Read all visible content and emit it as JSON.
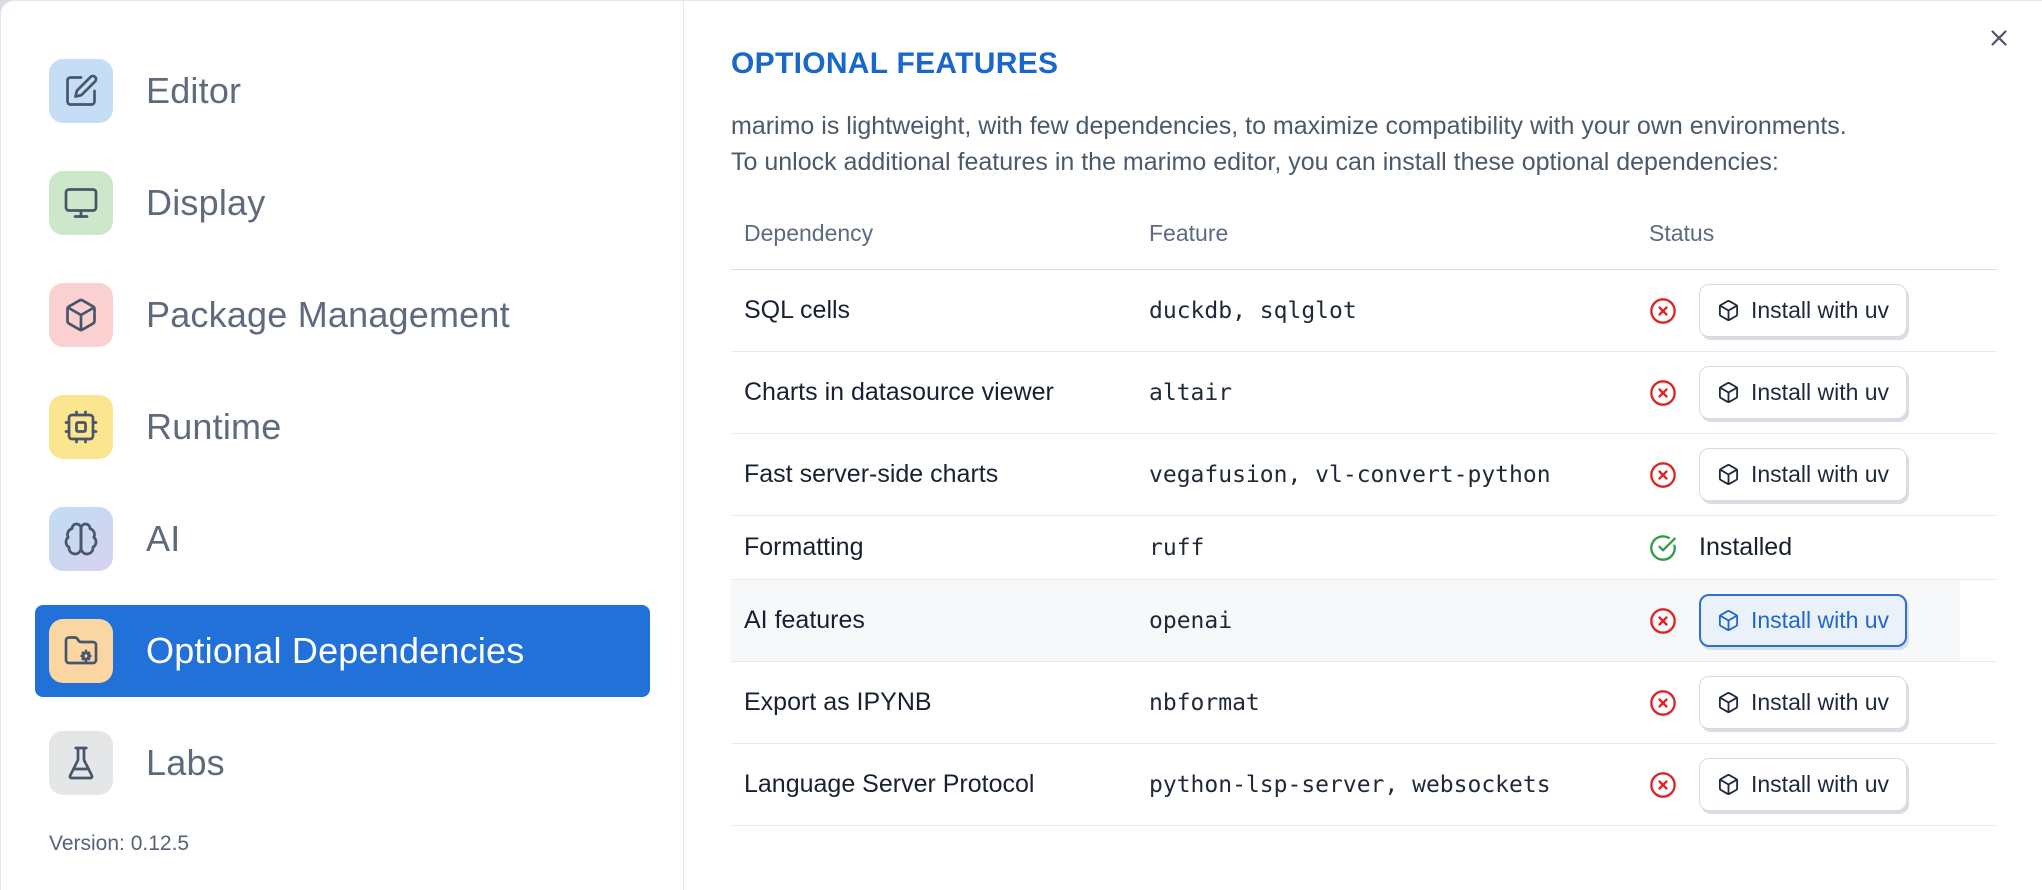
{
  "colors": {
    "accent": "#2171d8",
    "heading": "#1a67cb",
    "danger": "#dc2626",
    "success": "#2f9e44",
    "focus-border": "#2e6fd6",
    "focus-bg": "#eaf1fb",
    "focus-text": "#2166cc"
  },
  "sidebar": {
    "items": [
      {
        "label": "Editor",
        "icon": "square-pen-icon",
        "tile_bg": "#c5def5"
      },
      {
        "label": "Display",
        "icon": "monitor-icon",
        "tile_bg": "#cde7cb"
      },
      {
        "label": "Package Management",
        "icon": "box-icon",
        "tile_bg": "#fbd0d0"
      },
      {
        "label": "Runtime",
        "icon": "cpu-icon",
        "tile_bg": "#fbe58e"
      },
      {
        "label": "AI",
        "icon": "brain-icon",
        "tile_bg": "linear-gradient(145deg,#c3ddf4 0%,#ccd6f1 55%,#d9d2ef 100%)"
      },
      {
        "label": "Optional Dependencies",
        "icon": "folder-cog-icon",
        "tile_bg": "#fad7a2",
        "selected": true
      },
      {
        "label": "Labs",
        "icon": "flask-icon",
        "tile_bg": "#e5e6e8"
      }
    ],
    "version": "Version: 0.12.5"
  },
  "panel": {
    "title": "OPTIONAL FEATURES",
    "description_line1": "marimo is lightweight, with few dependencies, to maximize compatibility with your own environments.",
    "description_line2": "To unlock additional features in the marimo editor, you can install these optional dependencies:"
  },
  "table": {
    "headers": [
      "Dependency",
      "Feature",
      "Status"
    ],
    "install_label": "Install with uv",
    "installed_label": "Installed",
    "rows": [
      {
        "dependency": "SQL cells",
        "feature": "duckdb, sqlglot",
        "status": "missing"
      },
      {
        "dependency": "Charts in datasource viewer",
        "feature": "altair",
        "status": "missing"
      },
      {
        "dependency": "Fast server-side charts",
        "feature": "vegafusion, vl-convert-python",
        "status": "missing"
      },
      {
        "dependency": "Formatting",
        "feature": "ruff",
        "status": "installed"
      },
      {
        "dependency": "AI features",
        "feature": "openai",
        "status": "missing",
        "highlighted": true,
        "focused": true
      },
      {
        "dependency": "Export as IPYNB",
        "feature": "nbformat",
        "status": "missing"
      },
      {
        "dependency": "Language Server Protocol",
        "feature": "python-lsp-server, websockets",
        "status": "missing"
      }
    ]
  }
}
